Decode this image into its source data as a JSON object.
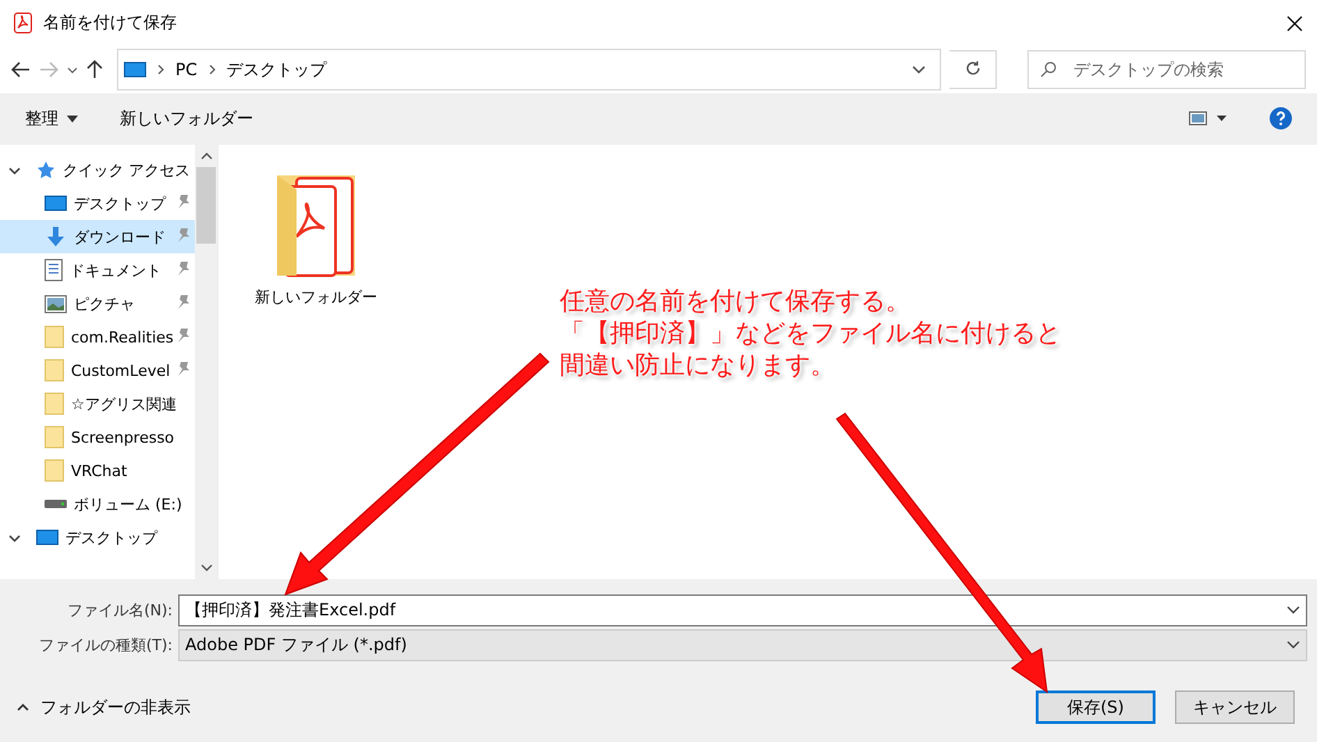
{
  "window": {
    "title": "名前を付けて保存"
  },
  "address": {
    "path": [
      "PC",
      "デスクトップ"
    ],
    "search_placeholder": "デスクトップの検索"
  },
  "toolbar": {
    "organize": "整理",
    "new_folder": "新しいフォルダー"
  },
  "nav": [
    {
      "label": "クイック アクセス",
      "kind": "star",
      "expanded": true,
      "selected": false,
      "children": [
        {
          "label": "デスクトップ",
          "kind": "monitor",
          "pinned": true,
          "selected": false
        },
        {
          "label": "ダウンロード",
          "kind": "download",
          "pinned": true,
          "selected": true
        },
        {
          "label": "ドキュメント",
          "kind": "document",
          "pinned": true,
          "selected": false
        },
        {
          "label": "ピクチャ",
          "kind": "picture",
          "pinned": true,
          "selected": false
        },
        {
          "label": "com.Realities",
          "kind": "folder",
          "pinned": true,
          "selected": false
        },
        {
          "label": "CustomLevel",
          "kind": "folder",
          "pinned": true,
          "selected": false
        },
        {
          "label": "☆アグリス関連",
          "kind": "folder",
          "pinned": false,
          "selected": false
        },
        {
          "label": "Screenpresso",
          "kind": "folder",
          "pinned": false,
          "selected": false
        },
        {
          "label": "VRChat",
          "kind": "folder",
          "pinned": false,
          "selected": false
        },
        {
          "label": "ボリューム (E:)",
          "kind": "drive",
          "pinned": false,
          "selected": false
        }
      ]
    },
    {
      "label": "デスクトップ",
      "kind": "monitor",
      "expanded": true,
      "selected": false
    }
  ],
  "files": [
    {
      "name": "新しいフォルダー"
    }
  ],
  "annotation": {
    "lines": [
      "任意の名前を付けて保存する。",
      "「【押印済】」などをファイル名に付けると",
      "間違い防止になります。"
    ]
  },
  "fields": [
    {
      "label": "ファイル名(N):",
      "value": "【押印済】発注書Excel.pdf",
      "kind": "input"
    },
    {
      "label": "ファイルの種類(T):",
      "value": "Adobe PDF ファイル (*.pdf)",
      "kind": "select"
    }
  ],
  "footer": {
    "hide_folders": "フォルダーの非表示",
    "save": "保存(S)",
    "cancel": "キャンセル"
  }
}
